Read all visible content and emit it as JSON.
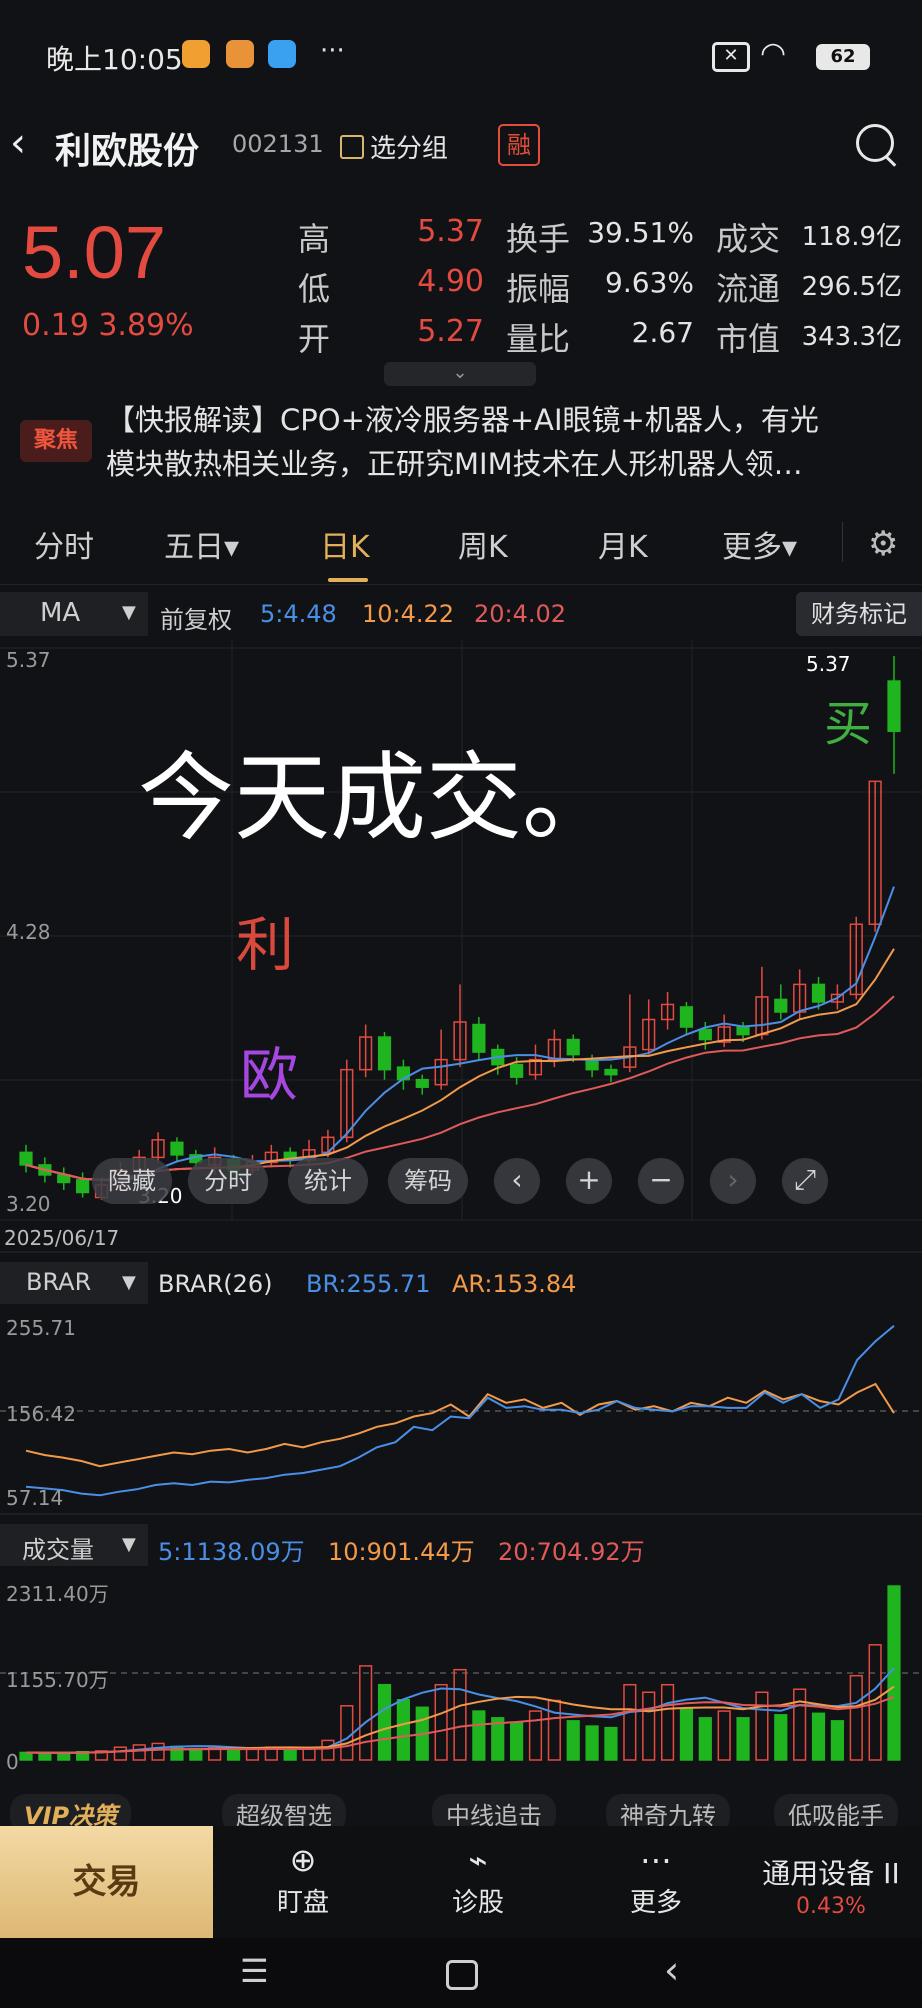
{
  "status_bar": {
    "time": "晚上10:05",
    "battery": "62",
    "more": "···"
  },
  "header": {
    "name": "利欧股份",
    "code": "002131",
    "group_label": "选分组",
    "badge": "融"
  },
  "quote": {
    "price": "5.07",
    "change": "0.19 3.89%",
    "rows": [
      [
        {
          "k": "高",
          "v": "5.37"
        },
        {
          "k": "换手",
          "v": "39.51%"
        },
        {
          "k": "成交",
          "v": "118.9亿"
        }
      ],
      [
        {
          "k": "低",
          "v": "4.90"
        },
        {
          "k": "振幅",
          "v": "9.63%"
        },
        {
          "k": "流通",
          "v": "296.5亿"
        }
      ],
      [
        {
          "k": "开",
          "v": "5.27"
        },
        {
          "k": "量比",
          "v": "2.67"
        },
        {
          "k": "市值",
          "v": "343.3亿"
        }
      ]
    ],
    "expand_icon": "chevron-down-icon"
  },
  "news": {
    "badge": "聚焦",
    "line1": "【快报解读】CPO+液冷服务器+AI眼镜+机器人，有光",
    "line2": "模块散热相关业务，正研究MIM技术在人形机器人领…"
  },
  "tabs": [
    "分时",
    "五日▾",
    "日K",
    "周K",
    "月K",
    "更多▾"
  ],
  "active_tab": "日K",
  "kline": {
    "indicator": "MA",
    "fq": "前复权",
    "ma5": "5:4.48",
    "ma10": "10:4.22",
    "ma20": "20:4.02",
    "fin_label": "财务标记",
    "y_top": "5.37",
    "y_mid": "4.28",
    "y_bot": "3.20",
    "high_label": "5.37",
    "low_label": "3.20",
    "date": "2025/06/17",
    "annotation": "今天成交。",
    "hand1": "利",
    "hand2": "欧",
    "hand3": "买",
    "controls": [
      "隐藏",
      "分时",
      "统计",
      "筹码"
    ]
  },
  "brar": {
    "indicator": "BRAR",
    "name": "BRAR(26)",
    "br": "BR:255.71",
    "ar": "AR:153.84",
    "y_top": "255.71",
    "y_mid": "156.42",
    "y_bot": "57.14"
  },
  "volume": {
    "indicator": "成交量",
    "v5": "5:1138.09万",
    "v10": "10:901.44万",
    "v20": "20:704.92万",
    "y_top": "2311.40万",
    "y_mid": "1155.70万",
    "y_bot": "0"
  },
  "strip": [
    "VIP决策",
    "超级智选",
    "中线追击",
    "神奇九转",
    "低吸能手"
  ],
  "bottom_nav": {
    "trade": "交易",
    "items": [
      "盯盘",
      "诊股",
      "更多"
    ],
    "sector": "通用设备 II",
    "sector_change": "0.43%"
  },
  "colors": {
    "up": "#e34b40",
    "down": "#1fb51f",
    "ma5": "#4a8fe6",
    "ma10": "#f29a4a",
    "ma20": "#e05a5a",
    "accent": "#e2b05a"
  },
  "chart_data": {
    "type": "candlestick",
    "title": "",
    "ylim": [
      3.2,
      5.37
    ],
    "candles": [
      {
        "o": 3.39,
        "c": 3.34,
        "h": 3.42,
        "l": 3.31
      },
      {
        "o": 3.34,
        "c": 3.3,
        "h": 3.37,
        "l": 3.27
      },
      {
        "o": 3.3,
        "c": 3.27,
        "h": 3.33,
        "l": 3.24
      },
      {
        "o": 3.28,
        "c": 3.23,
        "h": 3.31,
        "l": 3.21
      },
      {
        "o": 3.21,
        "c": 3.26,
        "h": 3.29,
        "l": 3.2
      },
      {
        "o": 3.26,
        "c": 3.32,
        "h": 3.35,
        "l": 3.24
      },
      {
        "o": 3.32,
        "c": 3.37,
        "h": 3.4,
        "l": 3.3
      },
      {
        "o": 3.37,
        "c": 3.44,
        "h": 3.47,
        "l": 3.35
      },
      {
        "o": 3.43,
        "c": 3.38,
        "h": 3.45,
        "l": 3.35
      },
      {
        "o": 3.38,
        "c": 3.35,
        "h": 3.4,
        "l": 3.32
      },
      {
        "o": 3.34,
        "c": 3.37,
        "h": 3.41,
        "l": 3.3
      },
      {
        "o": 3.36,
        "c": 3.32,
        "h": 3.38,
        "l": 3.3
      },
      {
        "o": 3.32,
        "c": 3.35,
        "h": 3.38,
        "l": 3.3
      },
      {
        "o": 3.35,
        "c": 3.39,
        "h": 3.42,
        "l": 3.33
      },
      {
        "o": 3.39,
        "c": 3.36,
        "h": 3.41,
        "l": 3.33
      },
      {
        "o": 3.36,
        "c": 3.4,
        "h": 3.44,
        "l": 3.34
      },
      {
        "o": 3.39,
        "c": 3.45,
        "h": 3.48,
        "l": 3.37
      },
      {
        "o": 3.45,
        "c": 3.72,
        "h": 3.76,
        "l": 3.43
      },
      {
        "o": 3.72,
        "c": 3.85,
        "h": 3.9,
        "l": 3.69
      },
      {
        "o": 3.85,
        "c": 3.72,
        "h": 3.87,
        "l": 3.68
      },
      {
        "o": 3.73,
        "c": 3.68,
        "h": 3.76,
        "l": 3.64
      },
      {
        "o": 3.68,
        "c": 3.65,
        "h": 3.7,
        "l": 3.62
      },
      {
        "o": 3.66,
        "c": 3.76,
        "h": 3.88,
        "l": 3.64
      },
      {
        "o": 3.76,
        "c": 3.91,
        "h": 4.06,
        "l": 3.73
      },
      {
        "o": 3.9,
        "c": 3.79,
        "h": 3.93,
        "l": 3.76
      },
      {
        "o": 3.8,
        "c": 3.74,
        "h": 3.82,
        "l": 3.7
      },
      {
        "o": 3.74,
        "c": 3.69,
        "h": 3.77,
        "l": 3.66
      },
      {
        "o": 3.7,
        "c": 3.76,
        "h": 3.82,
        "l": 3.68
      },
      {
        "o": 3.76,
        "c": 3.84,
        "h": 3.88,
        "l": 3.73
      },
      {
        "o": 3.84,
        "c": 3.78,
        "h": 3.86,
        "l": 3.75
      },
      {
        "o": 3.76,
        "c": 3.72,
        "h": 3.78,
        "l": 3.69
      },
      {
        "o": 3.72,
        "c": 3.7,
        "h": 3.74,
        "l": 3.67
      },
      {
        "o": 3.73,
        "c": 3.81,
        "h": 4.02,
        "l": 3.71
      },
      {
        "o": 3.8,
        "c": 3.92,
        "h": 4.0,
        "l": 3.78
      },
      {
        "o": 3.92,
        "c": 3.98,
        "h": 4.03,
        "l": 3.88
      },
      {
        "o": 3.97,
        "c": 3.89,
        "h": 3.99,
        "l": 3.86
      },
      {
        "o": 3.88,
        "c": 3.84,
        "h": 3.91,
        "l": 3.8
      },
      {
        "o": 3.83,
        "c": 3.89,
        "h": 3.94,
        "l": 3.81
      },
      {
        "o": 3.89,
        "c": 3.86,
        "h": 3.91,
        "l": 3.83
      },
      {
        "o": 3.86,
        "c": 4.01,
        "h": 4.13,
        "l": 3.84
      },
      {
        "o": 4.0,
        "c": 3.95,
        "h": 4.06,
        "l": 3.92
      },
      {
        "o": 3.95,
        "c": 4.06,
        "h": 4.12,
        "l": 3.92
      },
      {
        "o": 4.06,
        "c": 3.99,
        "h": 4.09,
        "l": 3.96
      },
      {
        "o": 3.99,
        "c": 4.02,
        "h": 4.06,
        "l": 3.96
      },
      {
        "o": 4.02,
        "c": 4.3,
        "h": 4.33,
        "l": 4.0
      },
      {
        "o": 4.3,
        "c": 4.87,
        "h": 4.87,
        "l": 4.27
      },
      {
        "o": 5.27,
        "c": 5.07,
        "h": 5.37,
        "l": 4.9
      }
    ],
    "brar": {
      "br": [
        68,
        66,
        64,
        60,
        58,
        62,
        65,
        70,
        72,
        70,
        74,
        73,
        76,
        78,
        82,
        84,
        88,
        92,
        102,
        114,
        120,
        138,
        134,
        150,
        148,
        172,
        160,
        162,
        158,
        158,
        154,
        158,
        168,
        160,
        158,
        156,
        162,
        162,
        160,
        160,
        178,
        166,
        176,
        160,
        170,
        216,
        238,
        256
      ],
      "ar": [
        110,
        105,
        102,
        98,
        92,
        96,
        100,
        104,
        108,
        106,
        110,
        112,
        108,
        112,
        118,
        114,
        120,
        124,
        130,
        138,
        142,
        150,
        154,
        164,
        150,
        176,
        166,
        170,
        160,
        166,
        152,
        164,
        168,
        158,
        162,
        156,
        166,
        162,
        172,
        166,
        180,
        170,
        176,
        168,
        164,
        178,
        188,
        154
      ]
    },
    "volume": [
      {
        "v": 100,
        "up": false
      },
      {
        "v": 95,
        "up": false
      },
      {
        "v": 90,
        "up": false
      },
      {
        "v": 110,
        "up": false
      },
      {
        "v": 120,
        "up": true
      },
      {
        "v": 170,
        "up": true
      },
      {
        "v": 200,
        "up": true
      },
      {
        "v": 220,
        "up": true
      },
      {
        "v": 180,
        "up": false
      },
      {
        "v": 150,
        "up": false
      },
      {
        "v": 160,
        "up": true
      },
      {
        "v": 140,
        "up": false
      },
      {
        "v": 150,
        "up": true
      },
      {
        "v": 170,
        "up": true
      },
      {
        "v": 130,
        "up": false
      },
      {
        "v": 150,
        "up": true
      },
      {
        "v": 260,
        "up": true
      },
      {
        "v": 720,
        "up": true
      },
      {
        "v": 1250,
        "up": true
      },
      {
        "v": 1000,
        "up": false
      },
      {
        "v": 800,
        "up": false
      },
      {
        "v": 700,
        "up": false
      },
      {
        "v": 1000,
        "up": true
      },
      {
        "v": 1200,
        "up": true
      },
      {
        "v": 650,
        "up": false
      },
      {
        "v": 560,
        "up": false
      },
      {
        "v": 500,
        "up": false
      },
      {
        "v": 650,
        "up": true
      },
      {
        "v": 790,
        "up": true
      },
      {
        "v": 520,
        "up": false
      },
      {
        "v": 450,
        "up": false
      },
      {
        "v": 430,
        "up": false
      },
      {
        "v": 1000,
        "up": true
      },
      {
        "v": 900,
        "up": true
      },
      {
        "v": 1000,
        "up": true
      },
      {
        "v": 680,
        "up": false
      },
      {
        "v": 560,
        "up": false
      },
      {
        "v": 650,
        "up": true
      },
      {
        "v": 560,
        "up": false
      },
      {
        "v": 900,
        "up": true
      },
      {
        "v": 600,
        "up": false
      },
      {
        "v": 940,
        "up": true
      },
      {
        "v": 620,
        "up": false
      },
      {
        "v": 520,
        "up": false
      },
      {
        "v": 1120,
        "up": true
      },
      {
        "v": 1530,
        "up": true
      },
      {
        "v": 2311,
        "up": false
      }
    ]
  }
}
